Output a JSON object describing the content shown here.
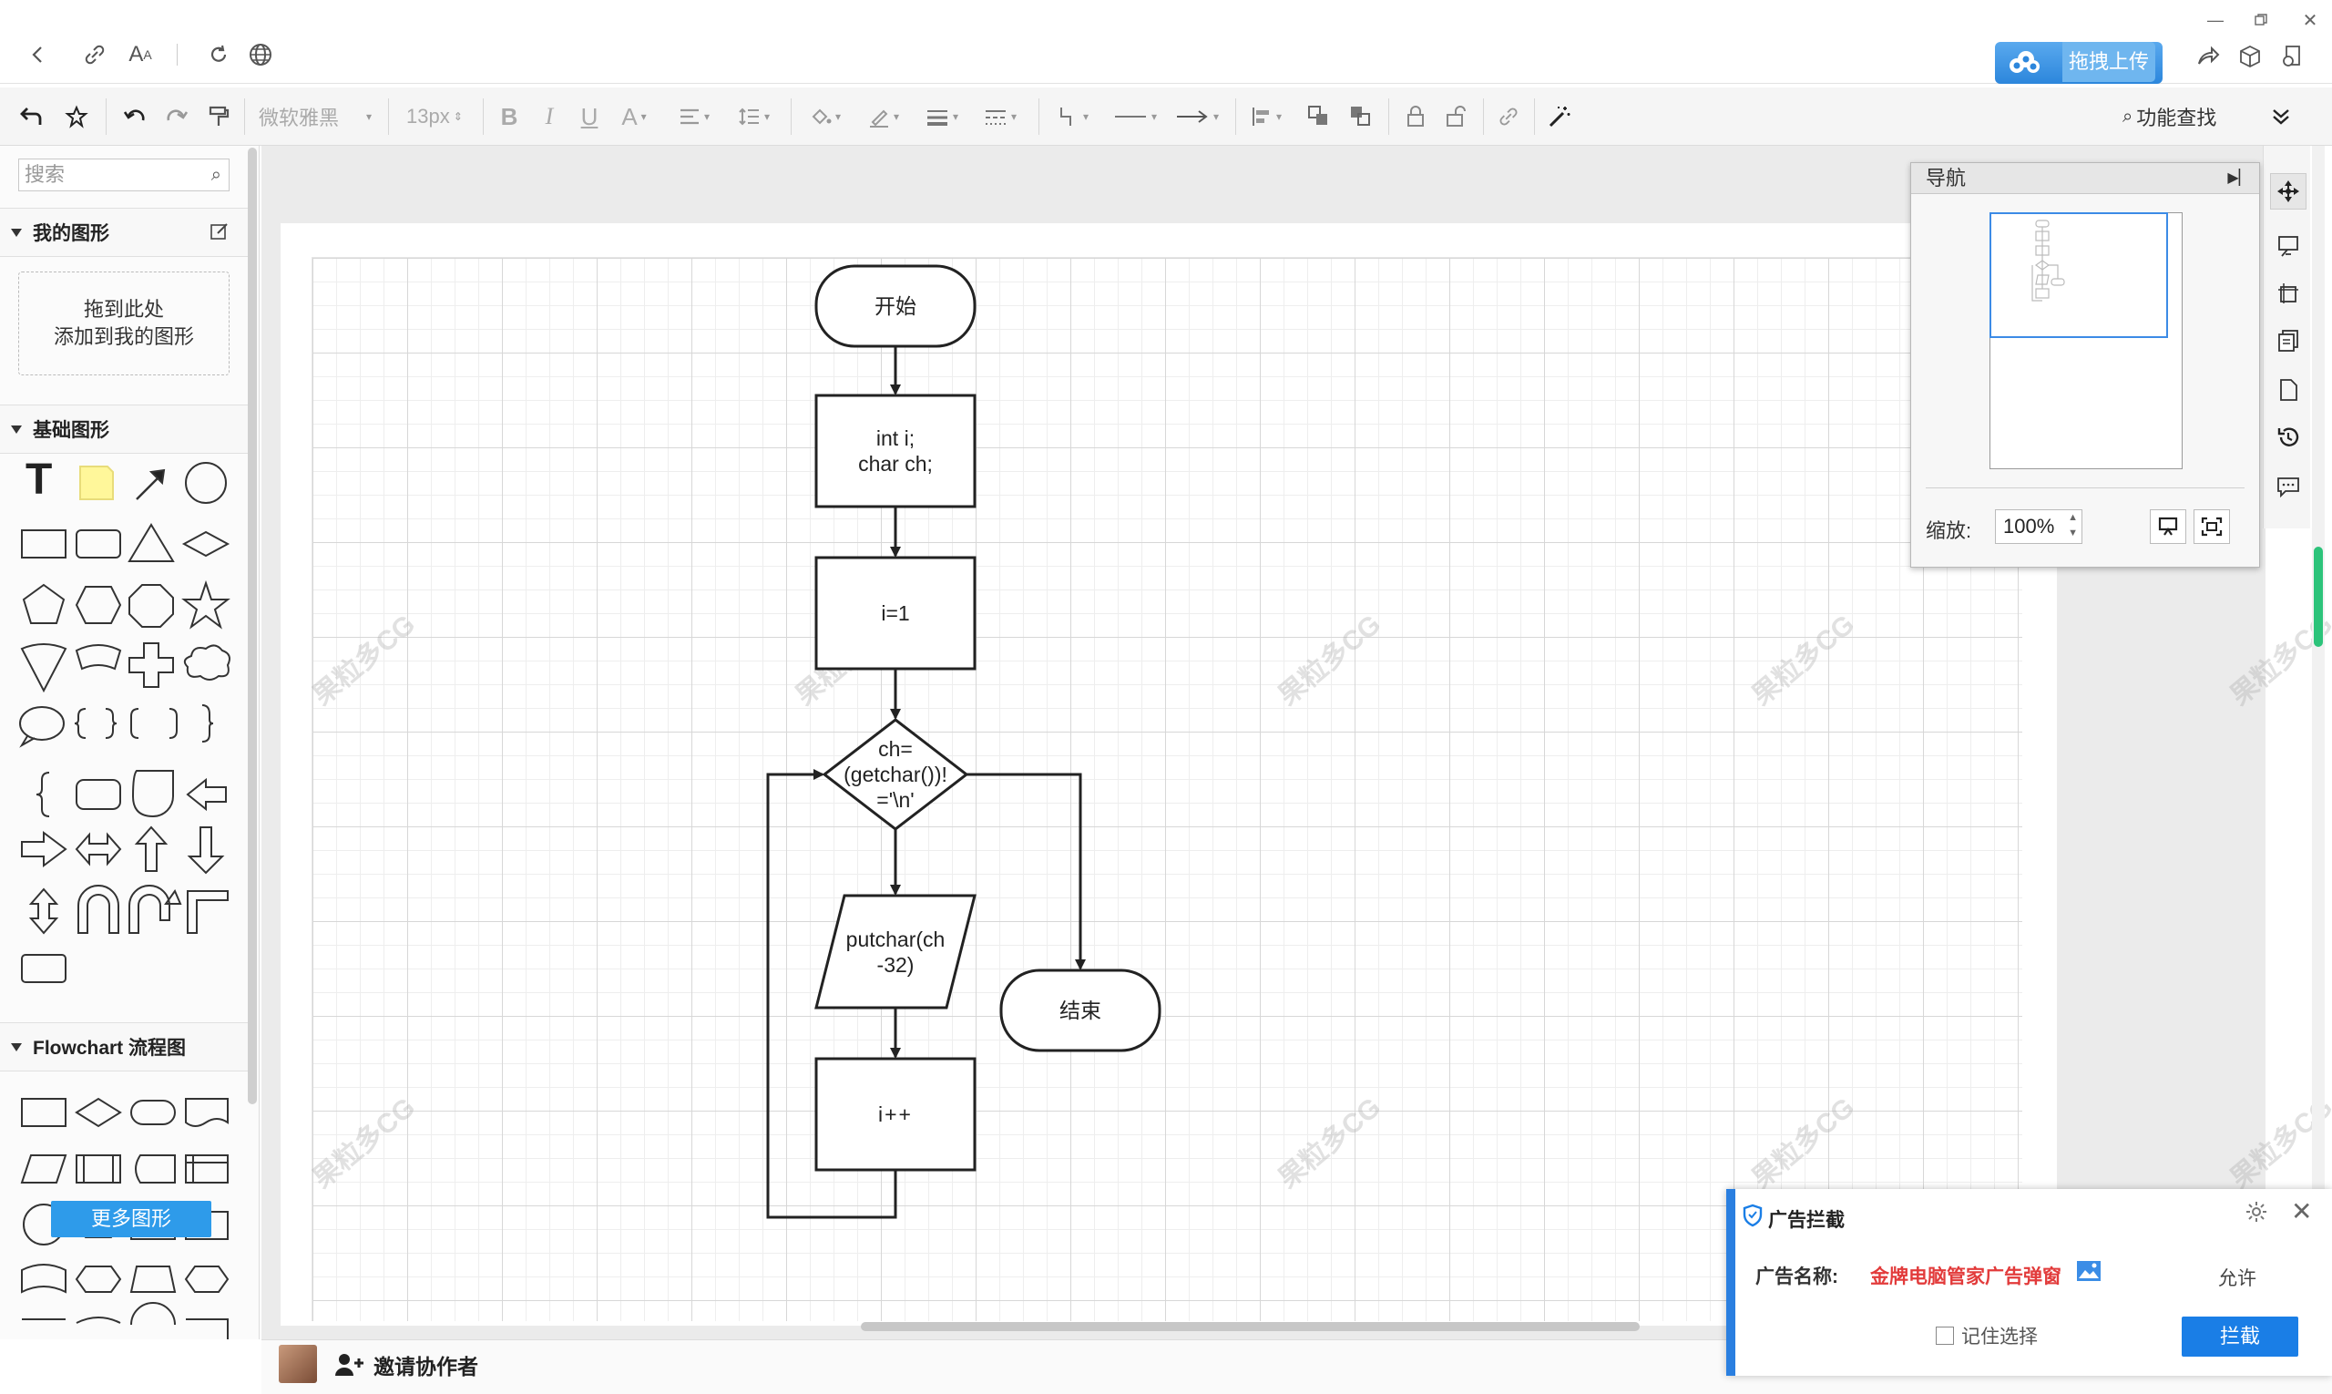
{
  "toolbar": {
    "font_name": "微软雅黑",
    "font_size": "13px",
    "find_label": "功能查找"
  },
  "upload": {
    "label": "拖拽上传"
  },
  "sidebar": {
    "search_placeholder": "搜索",
    "my_shapes_title": "我的图形",
    "drop_hint_line1": "拖到此处",
    "drop_hint_line2": "添加到我的图形",
    "basic_title": "基础图形",
    "flowchart_title": "Flowchart 流程图",
    "more_shapes": "更多图形"
  },
  "flowchart": {
    "start": "开始",
    "decl_line1": "int i;",
    "decl_line2": "char ch;",
    "init": "i=1",
    "cond_line1": "ch=",
    "cond_line2": "(getchar())!",
    "cond_line3": "='\\n'",
    "io_line1": "putchar(ch",
    "io_line2": "-32)",
    "incr": "i++",
    "end": "结束"
  },
  "watermark": "果粒多CG",
  "nav": {
    "title": "导航",
    "zoom_label": "缩放:",
    "zoom_value": "100%"
  },
  "bottom": {
    "invite": "邀请协作者"
  },
  "ad": {
    "title": "广告拦截",
    "name_label": "广告名称:",
    "name_value": "金牌电脑管家广告弹窗",
    "allow": "允许",
    "remember": "记住选择",
    "block": "拦截"
  },
  "colors": {
    "accent": "#2e9bea",
    "ad_red": "#e23b3b",
    "ad_blue": "#1a7ee6",
    "scroll_green": "#2cc37a"
  }
}
